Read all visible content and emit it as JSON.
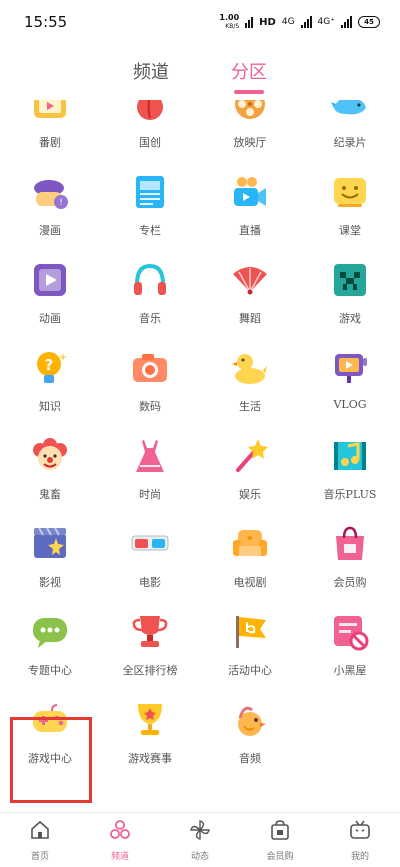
{
  "status_bar": {
    "time": "15:55",
    "speed_value": "1.00",
    "speed_unit": "KB/S",
    "hd": "HD",
    "net1": "4G",
    "net2": "4G⁺",
    "battery": "45"
  },
  "top_tabs": [
    {
      "label": "频道",
      "active": false
    },
    {
      "label": "分区",
      "active": true
    }
  ],
  "grid_items": [
    {
      "label": "番剧",
      "icon": "tv-icon"
    },
    {
      "label": "国创",
      "icon": "peach-icon"
    },
    {
      "label": "放映厅",
      "icon": "film-reel-icon"
    },
    {
      "label": "纪录片",
      "icon": "whale-icon"
    },
    {
      "label": "漫画",
      "icon": "beret-icon"
    },
    {
      "label": "专栏",
      "icon": "article-icon"
    },
    {
      "label": "直播",
      "icon": "camera-icon"
    },
    {
      "label": "课堂",
      "icon": "smile-board-icon"
    },
    {
      "label": "动画",
      "icon": "play-square-icon"
    },
    {
      "label": "音乐",
      "icon": "headphones-icon"
    },
    {
      "label": "舞蹈",
      "icon": "fan-icon"
    },
    {
      "label": "游戏",
      "icon": "creeper-icon"
    },
    {
      "label": "知识",
      "icon": "lightbulb-icon"
    },
    {
      "label": "数码",
      "icon": "photo-camera-icon"
    },
    {
      "label": "生活",
      "icon": "duck-icon"
    },
    {
      "label": "VLOG",
      "icon": "vlog-camera-icon"
    },
    {
      "label": "鬼畜",
      "icon": "clown-icon"
    },
    {
      "label": "时尚",
      "icon": "dress-icon"
    },
    {
      "label": "娱乐",
      "icon": "star-wand-icon"
    },
    {
      "label": "音乐PLUS",
      "icon": "music-note-icon"
    },
    {
      "label": "影视",
      "icon": "clapper-icon"
    },
    {
      "label": "电影",
      "icon": "3d-glasses-icon"
    },
    {
      "label": "电视剧",
      "icon": "sofa-icon"
    },
    {
      "label": "会员购",
      "icon": "shopping-bag-icon"
    },
    {
      "label": "专题中心",
      "icon": "chat-bubble-icon"
    },
    {
      "label": "全区排行榜",
      "icon": "trophy-icon"
    },
    {
      "label": "活动中心",
      "icon": "flag-icon"
    },
    {
      "label": "小黑屋",
      "icon": "blocked-icon"
    },
    {
      "label": "游戏中心",
      "icon": "gamepad-icon"
    },
    {
      "label": "游戏赛事",
      "icon": "cup-icon"
    },
    {
      "label": "音频",
      "icon": "bird-icon"
    }
  ],
  "bottom_nav": [
    {
      "label": "首页",
      "icon": "home-icon",
      "active": false
    },
    {
      "label": "频道",
      "icon": "channel-icon",
      "active": true
    },
    {
      "label": "动态",
      "icon": "pinwheel-icon",
      "active": false
    },
    {
      "label": "会员购",
      "icon": "bag-icon",
      "active": false
    },
    {
      "label": "我的",
      "icon": "tv-face-icon",
      "active": false
    }
  ],
  "colors": {
    "accent": "#f06292",
    "highlight": "#e53935"
  }
}
